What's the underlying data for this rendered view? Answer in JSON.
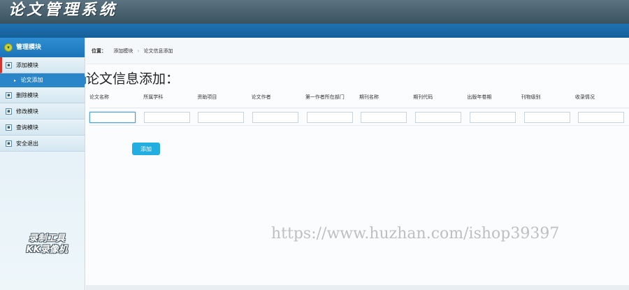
{
  "app": {
    "title": "论文管理系统"
  },
  "sidebar": {
    "header": "管理模块",
    "header_icon": "chevron-down-icon",
    "items": [
      {
        "label": "添加模块",
        "icon": "doc-icon"
      },
      {
        "label": "删除模块",
        "icon": "doc-icon"
      },
      {
        "label": "修改模块",
        "icon": "doc-icon"
      },
      {
        "label": "查询模块",
        "icon": "doc-icon"
      },
      {
        "label": "安全退出",
        "icon": "doc-icon"
      }
    ],
    "active_sub": "论文添加",
    "watermark_line1": "录制工具",
    "watermark_line2": "KK录像机"
  },
  "breadcrumb": {
    "lead": "位置：",
    "crumbs": [
      "添加模块",
      "论文信息添加"
    ]
  },
  "page": {
    "heading": "论文信息添加："
  },
  "form": {
    "columns": [
      "论文名称",
      "所属学科",
      "资助项目",
      "论文作者",
      "第一作者所在部门",
      "期刊名称",
      "期刊代码",
      "出版年卷期",
      "刊物级别",
      "收录情况"
    ],
    "values": [
      "",
      "",
      "",
      "",
      "",
      "",
      "",
      "",
      "",
      ""
    ],
    "submit_label": "添加"
  },
  "colors": {
    "accent": "#23aee2",
    "header_dark": "#3e5764",
    "header_bar": "#1f72b2",
    "sidebar_active": "#2a86c9"
  },
  "overlay": {
    "url_watermark": "https://www.huzhan.com/ishop39397"
  }
}
